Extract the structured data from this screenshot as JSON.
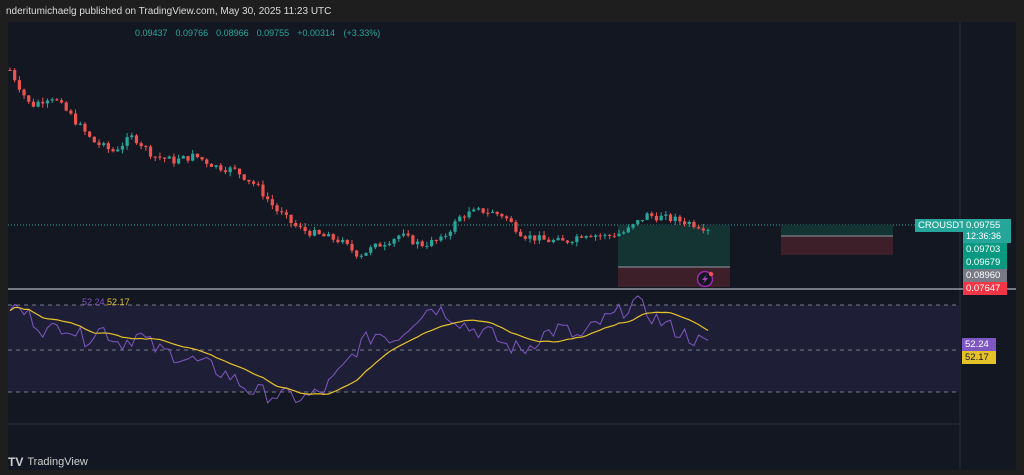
{
  "header": {
    "text": "nderitumichaelg published on TradingView.com, May 30, 2025 11:23 UTC"
  },
  "ohlc": {
    "open": "0.09437",
    "high": "0.09766",
    "low": "0.08966",
    "close": "0.09755",
    "change": "+0.00314 (+3.33%)"
  },
  "price_axis": {
    "symbol": "CROUSDT",
    "last": "0.09755",
    "countdown": "12:36:36",
    "level1": "0.09703",
    "level2": "0.09679",
    "level3": "0.08960",
    "level4": "0.07647"
  },
  "rsi": {
    "value": "52.24",
    "ma": "52.17",
    "levels": [
      70,
      50,
      30
    ]
  },
  "colors": {
    "up": "#26a69a",
    "down": "#ef5350",
    "rsi": "#7e57c2",
    "ma": "#e6c229"
  },
  "footer": {
    "brand": "TradingView"
  },
  "series": {
    "price_anchors": [
      0.0999,
      0.0943,
      0.0959,
      0.0927,
      0.0889,
      0.0873,
      0.0896,
      0.0866,
      0.0858,
      0.0866,
      0.085,
      0.0843,
      0.082,
      0.0781,
      0.0754,
      0.0743,
      0.0735,
      0.0712,
      0.0728,
      0.0743,
      0.0728,
      0.0735,
      0.0774,
      0.0781,
      0.0774,
      0.0743,
      0.0735,
      0.0732,
      0.0746,
      0.0741,
      0.0748,
      0.0774,
      0.0769,
      0.0763,
      0.0754
    ],
    "rsi_anchors": [
      70,
      66,
      58,
      62,
      55,
      60,
      53,
      57,
      50,
      48,
      45,
      42,
      38,
      32,
      30,
      29,
      28,
      31,
      40,
      52,
      58,
      55,
      64,
      70,
      66,
      60,
      58,
      52,
      50,
      57,
      60,
      55,
      62,
      66,
      72,
      65,
      60,
      56,
      52
    ]
  }
}
